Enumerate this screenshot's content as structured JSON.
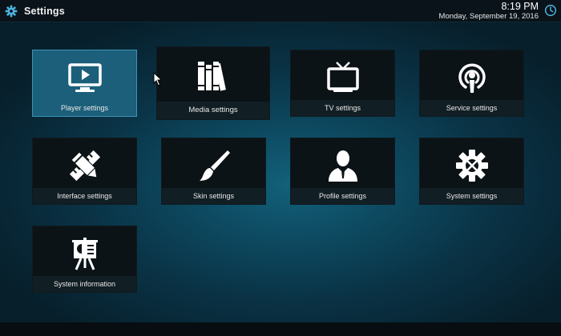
{
  "header": {
    "title": "Settings",
    "time": "8:19 PM",
    "date": "Monday, September 19, 2016"
  },
  "tiles": [
    {
      "label": "Player settings",
      "icon": "monitor-play-icon",
      "state": "focused"
    },
    {
      "label": "Media settings",
      "icon": "books-icon",
      "state": "hover"
    },
    {
      "label": "TV settings",
      "icon": "tv-antenna-icon",
      "state": "normal"
    },
    {
      "label": "Service settings",
      "icon": "podcast-icon",
      "state": "normal"
    },
    {
      "label": "Interface settings",
      "icon": "pencil-ruler-icon",
      "state": "normal"
    },
    {
      "label": "Skin settings",
      "icon": "paintbrush-icon",
      "state": "normal"
    },
    {
      "label": "Profile settings",
      "icon": "user-silhouette-icon",
      "state": "normal"
    },
    {
      "label": "System settings",
      "icon": "gear-tools-icon",
      "state": "normal"
    },
    {
      "label": "System information",
      "icon": "presentation-board-icon",
      "state": "normal"
    }
  ],
  "colors": {
    "accent": "#1c5f7a",
    "focus_border": "#3d93b5",
    "tile_bg": "#0b1317",
    "label_bg": "#111e24",
    "header_icon": "#4fb3e0"
  }
}
